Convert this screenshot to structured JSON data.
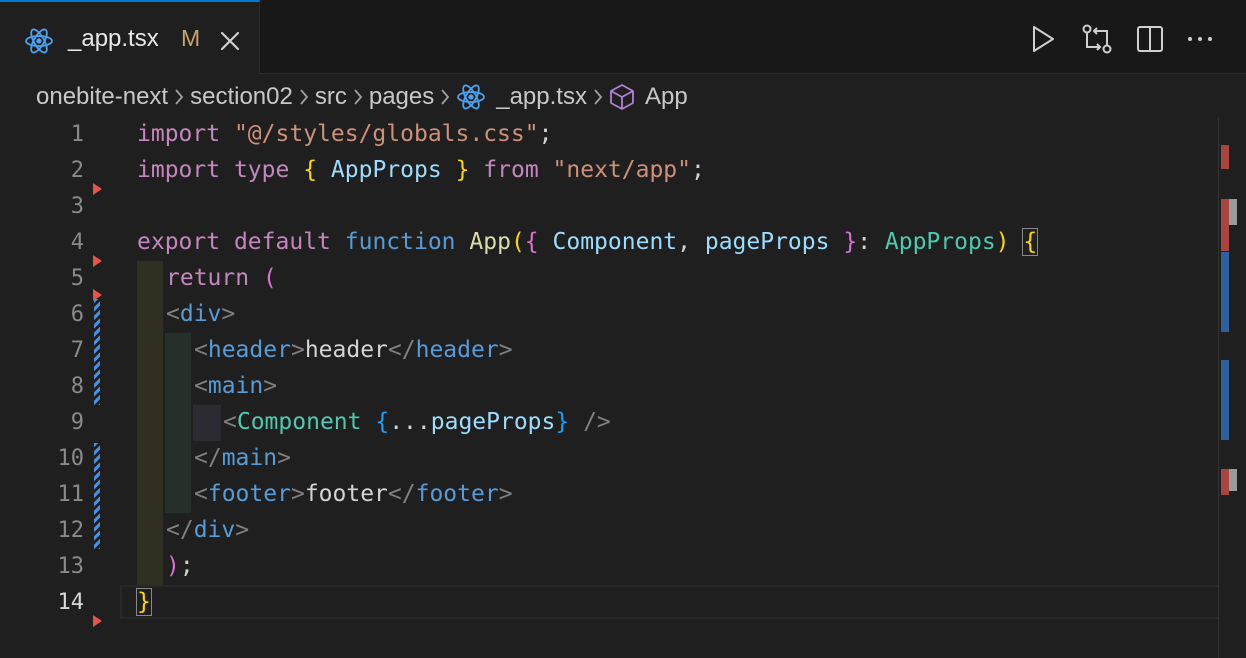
{
  "tab": {
    "filename": "_app.tsx",
    "status": "M"
  },
  "breadcrumb": [
    {
      "label": "onebite-next",
      "icon": null
    },
    {
      "label": "section02",
      "icon": null
    },
    {
      "label": "src",
      "icon": null
    },
    {
      "label": "pages",
      "icon": null
    },
    {
      "label": "_app.tsx",
      "icon": "react-icon"
    },
    {
      "label": "App",
      "icon": "cube-icon"
    }
  ],
  "editor": {
    "line_numbers": [
      "1",
      "2",
      "3",
      "4",
      "5",
      "6",
      "7",
      "8",
      "9",
      "10",
      "11",
      "12",
      "13",
      "14"
    ],
    "active_line": "14",
    "lines": {
      "l1": [
        "import",
        " ",
        "\"@/styles/globals.css\"",
        ";"
      ],
      "l2": [
        "import",
        " ",
        "type",
        " ",
        "{",
        " ",
        "AppProps",
        " ",
        "}",
        " ",
        "from",
        " ",
        "\"next/app\"",
        ";"
      ],
      "l4": [
        "export",
        " ",
        "default",
        " ",
        "function",
        " ",
        "App",
        "(",
        "{",
        " ",
        "Component",
        ", ",
        "pageProps",
        " ",
        "}",
        ": ",
        "AppProps",
        ")",
        " ",
        "{"
      ],
      "l5": [
        "return",
        " ",
        "("
      ],
      "l6": [
        "<",
        "div",
        ">"
      ],
      "l7": [
        "<",
        "header",
        ">",
        "header",
        "</",
        "header",
        ">"
      ],
      "l8": [
        "<",
        "main",
        ">"
      ],
      "l9": [
        "<",
        "Component",
        " ",
        "{",
        "...",
        "pageProps",
        "}",
        " />"
      ],
      "l10": [
        "</",
        "main",
        ">"
      ],
      "l11": [
        "<",
        "footer",
        ">",
        "footer",
        "</",
        "footer",
        ">"
      ],
      "l12": [
        "</",
        "div",
        ">"
      ],
      "l13": [
        ")",
        ";"
      ],
      "l14": [
        "}"
      ]
    }
  },
  "colors": {
    "accent": "#0078d4",
    "modified": "#c7a36a",
    "deleted_marker": "#e5534b",
    "changed_marker": "#4a90e2"
  },
  "icons": {
    "run": "play-icon",
    "compare": "compare-changes-icon",
    "split": "split-editor-icon",
    "more": "more-actions-icon",
    "close": "close-icon"
  }
}
